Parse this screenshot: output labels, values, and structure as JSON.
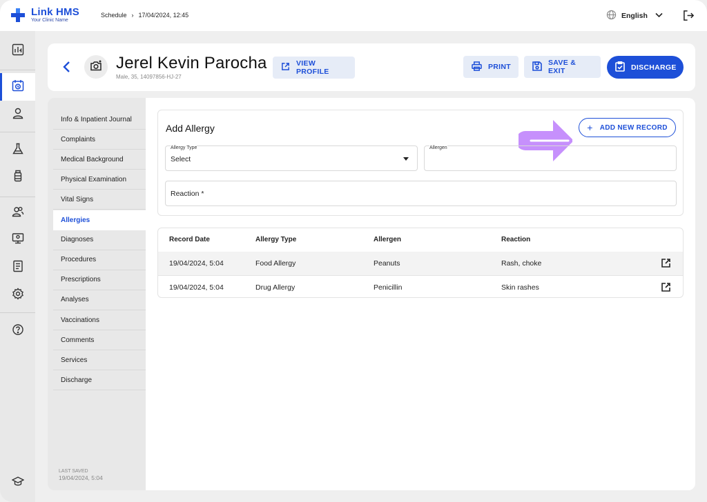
{
  "app": {
    "name": "Link HMS",
    "clinic": "Your Clinic Name"
  },
  "breadcrumb": {
    "first": "Schedule",
    "sep": "›",
    "second": "17/04/2024, 12:45"
  },
  "language": "English",
  "patient": {
    "name": "Jerel Kevin Parocha",
    "meta": "Male, 35, 14097856-HJ-27"
  },
  "buttons": {
    "view_profile": "VIEW PROFILE",
    "print": "PRINT",
    "save_exit": "SAVE & EXIT",
    "discharge": "DISCHARGE",
    "add_new": "ADD NEW RECORD"
  },
  "nav": [
    {
      "label": "Info & Inpatient Journal"
    },
    {
      "label": "Complaints"
    },
    {
      "label": "Medical Background"
    },
    {
      "label": "Physical Examination"
    },
    {
      "label": "Vital Signs"
    },
    {
      "label": "Allergies",
      "active": true
    },
    {
      "label": "Diagnoses"
    },
    {
      "label": "Procedures"
    },
    {
      "label": "Prescriptions"
    },
    {
      "label": "Analyses"
    },
    {
      "label": "Vaccinations"
    },
    {
      "label": "Comments"
    },
    {
      "label": "Services"
    },
    {
      "label": "Discharge"
    }
  ],
  "last_saved": {
    "label": "LAST SAVED",
    "date": "19/04/2024, 5:04"
  },
  "form": {
    "title": "Add Allergy",
    "allergy_type": {
      "label": "Allergy Type",
      "value": "Select"
    },
    "allergen": {
      "label": "Allergen",
      "value": ""
    },
    "reaction": {
      "placeholder": "Reaction *"
    }
  },
  "table": {
    "headers": [
      "Record Date",
      "Allergy Type",
      "Allergen",
      "Reaction"
    ],
    "rows": [
      [
        "19/04/2024, 5:04",
        "Food Allergy",
        "Peanuts",
        "Rash, choke"
      ],
      [
        "19/04/2024, 5:04",
        "Drug Allergy",
        "Penicillin",
        "Skin rashes"
      ]
    ]
  },
  "colors": {
    "primary": "#1d4fd8",
    "highlight_arrow": "#c084fc",
    "button_bg": "#e6ecf7"
  },
  "rail_icons": [
    "dashboard-icon",
    "calendar-icon",
    "user-icon",
    "lab-flask-icon",
    "medicine-bottle-icon",
    "patients-icon",
    "monitor-icon",
    "report-icon",
    "settings-icon",
    "help-icon",
    "graduation-cap-icon"
  ]
}
